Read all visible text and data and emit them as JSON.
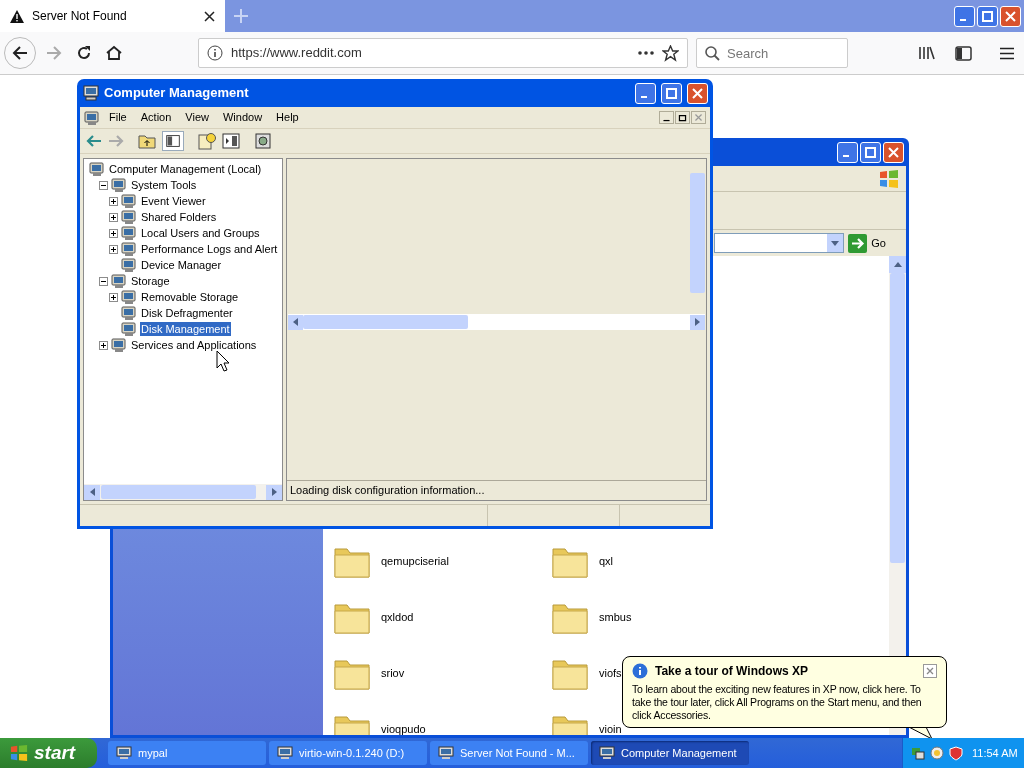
{
  "browser": {
    "tab": {
      "title": "Server Not Found"
    },
    "url": "https://www.reddit.com",
    "search": {
      "placeholder": "Search"
    }
  },
  "mmc": {
    "title": "Computer Management",
    "menu": [
      "File",
      "Action",
      "View",
      "Window",
      "Help"
    ],
    "tree": [
      {
        "label": "Computer Management (Local)",
        "kind": "root",
        "selected": false,
        "children": [
          {
            "label": "System Tools",
            "kind": "branch",
            "expanded": true,
            "selected": false,
            "children": [
              {
                "label": "Event Viewer",
                "kind": "branch",
                "expanded": false,
                "selected": false
              },
              {
                "label": "Shared Folders",
                "kind": "branch",
                "expanded": false,
                "selected": false
              },
              {
                "label": "Local Users and Groups",
                "kind": "branch",
                "expanded": false,
                "selected": false
              },
              {
                "label": "Performance Logs and Alert",
                "kind": "branch",
                "expanded": false,
                "selected": false
              },
              {
                "label": "Device Manager",
                "kind": "leaf",
                "selected": false
              }
            ]
          },
          {
            "label": "Storage",
            "kind": "branch",
            "expanded": true,
            "selected": false,
            "children": [
              {
                "label": "Removable Storage",
                "kind": "branch",
                "expanded": false,
                "selected": false
              },
              {
                "label": "Disk Defragmenter",
                "kind": "leaf",
                "selected": false
              },
              {
                "label": "Disk Management",
                "kind": "leaf",
                "selected": true
              }
            ]
          },
          {
            "label": "Services and Applications",
            "kind": "branch",
            "expanded": false,
            "selected": false
          }
        ]
      }
    ],
    "status": "Loading disk configuration information..."
  },
  "explorer": {
    "go": "Go",
    "folders": [
      "qemupciserial",
      "qxl",
      "qxldod",
      "smbus",
      "sriov",
      "viofs",
      "vioqpudo",
      "vioin"
    ]
  },
  "balloon": {
    "title": "Take a tour of Windows XP",
    "text": "To learn about the exciting new features in XP now, click here. To take the tour later, click All Programs on the Start menu, and then click Accessories."
  },
  "taskbar": {
    "start": "start",
    "tasks": [
      {
        "label": "mypal",
        "selected": false
      },
      {
        "label": "virtio-win-0.1.240 (D:)",
        "selected": false
      },
      {
        "label": "Server Not Found - M...",
        "selected": false
      },
      {
        "label": "Computer Management",
        "selected": true
      }
    ],
    "clock": "11:54 AM"
  }
}
